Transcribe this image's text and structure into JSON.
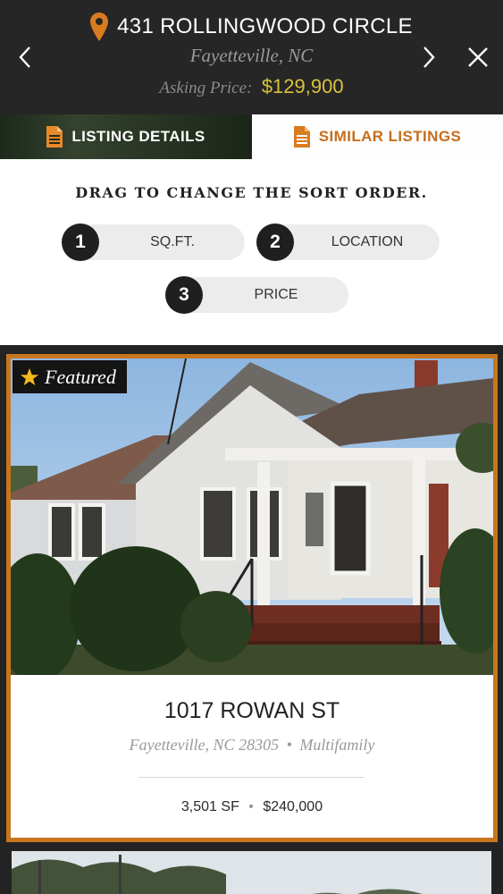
{
  "header": {
    "title": "431 ROLLINGWOOD CIRCLE",
    "city": "Fayetteville, NC",
    "price_label": "Asking Price:",
    "price_value": "$129,900",
    "icons": {
      "location": "map-pin-icon",
      "prev": "chevron-left-icon",
      "next": "chevron-right-icon",
      "close": "close-icon"
    },
    "colors": {
      "pin": "#d97b1f",
      "price": "#d9c23c"
    }
  },
  "tabs": [
    {
      "label": "LISTING DETAILS",
      "icon": "document-icon",
      "active": false
    },
    {
      "label": "SIMILAR LISTINGS",
      "icon": "document-icon",
      "active": true
    }
  ],
  "sort": {
    "heading": "DRAG TO CHANGE THE SORT ORDER.",
    "options": [
      {
        "number": "1",
        "label": "SQ.FT."
      },
      {
        "number": "2",
        "label": "LOCATION"
      },
      {
        "number": "3",
        "label": "PRICE"
      }
    ]
  },
  "listing": {
    "badge": "Featured",
    "badge_icon": "star-icon",
    "title": "1017 ROWAN ST",
    "location": "Fayetteville, NC 28305",
    "type": "Multifamily",
    "sep": "•",
    "sqft": "3,501 SF",
    "price": "$240,000",
    "border_color": "#c8761d"
  }
}
